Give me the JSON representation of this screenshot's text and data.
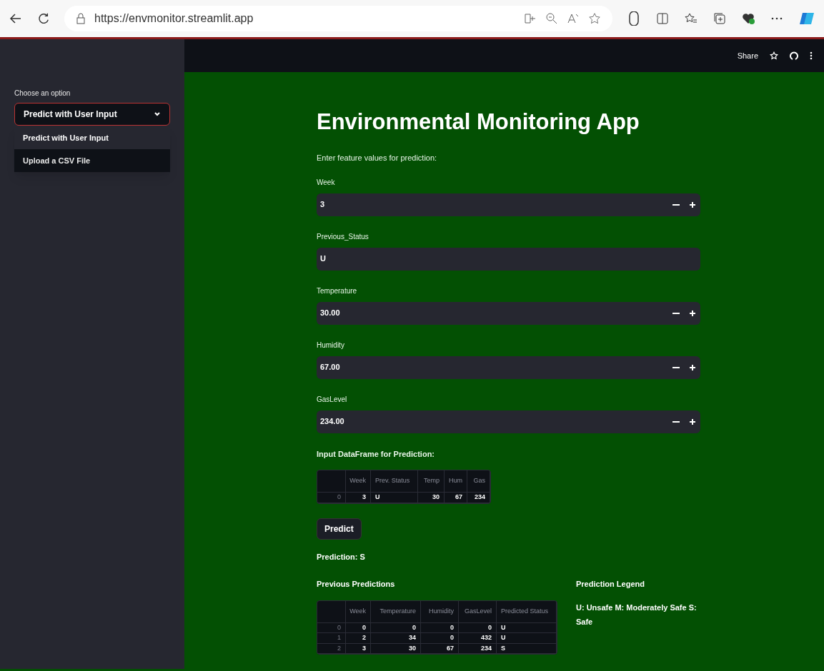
{
  "browser": {
    "url": "https://envmonitor.streamlit.app"
  },
  "header": {
    "share": "Share"
  },
  "sidebar": {
    "label": "Choose an option",
    "select_value": "Predict with User Input",
    "options": [
      {
        "label": "Predict with User Input",
        "selected": true,
        "hovered": false
      },
      {
        "label": "Upload a CSV File",
        "selected": false,
        "hovered": true
      }
    ]
  },
  "main": {
    "title": "Environmental Monitoring App",
    "intro": "Enter feature values for prediction:",
    "fields": [
      {
        "label": "Week",
        "kind": "number",
        "value": "3"
      },
      {
        "label": "Previous_Status",
        "kind": "text",
        "value": "U"
      },
      {
        "label": "Temperature",
        "kind": "number",
        "value": "30.00"
      },
      {
        "label": "Humidity",
        "kind": "number",
        "value": "67.00"
      },
      {
        "label": "GasLevel",
        "kind": "number",
        "value": "234.00"
      }
    ],
    "input_table": {
      "title": "Input DataFrame for Prediction:",
      "columns": [
        {
          "label": "Week",
          "kind": "number"
        },
        {
          "label": "Prev. Status",
          "kind": "text"
        },
        {
          "label": "Temp",
          "kind": "number"
        },
        {
          "label": "Hum",
          "kind": "number"
        },
        {
          "label": "Gas",
          "kind": "number"
        }
      ],
      "rows": [
        {
          "index": "0",
          "cells": [
            "3",
            "U",
            "30",
            "67",
            "234"
          ]
        }
      ]
    },
    "predict_button": "Predict",
    "prediction": "Prediction: S",
    "history_table": {
      "title": "Previous Predictions",
      "columns": [
        {
          "label": "Week",
          "kind": "number"
        },
        {
          "label": "Temperature",
          "kind": "number"
        },
        {
          "label": "Humidity",
          "kind": "number"
        },
        {
          "label": "GasLevel",
          "kind": "number"
        },
        {
          "label": "Predicted Status",
          "kind": "text"
        }
      ],
      "rows": [
        {
          "index": "0",
          "cells": [
            "0",
            "0",
            "0",
            "0",
            "U"
          ]
        },
        {
          "index": "1",
          "cells": [
            "2",
            "34",
            "0",
            "432",
            "U"
          ]
        },
        {
          "index": "2",
          "cells": [
            "3",
            "30",
            "67",
            "234",
            "S"
          ]
        }
      ]
    },
    "legend": {
      "title": "Prediction Legend",
      "text": "U: Unsafe M: Moderately Safe S: Safe"
    }
  }
}
